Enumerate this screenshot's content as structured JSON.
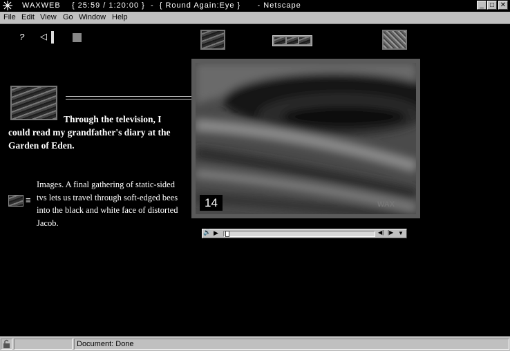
{
  "window": {
    "app_name": "WAXWEB",
    "timecode": "{ 25:59 / 1:20:00 }",
    "separator": "-",
    "page_title": "{ Round Again:Eye }",
    "browser_suffix": "- Netscape",
    "minimize_glyph": "_",
    "maximize_glyph": "□",
    "close_glyph": "✕"
  },
  "menu": {
    "items": [
      "File",
      "Edit",
      "View",
      "Go",
      "Window",
      "Help"
    ]
  },
  "toolbar": {
    "help_glyph": "?",
    "back_glyph": "◁"
  },
  "content": {
    "caption": "Through the television, I could read my grandfather's diary at the Garden of Eden.",
    "images_note": "Images. A final gathering of static-sided tvs lets us travel through soft-edged bees into the black and white face of distorted Jacob.",
    "list_glyph": "≡"
  },
  "video": {
    "frame_number": "14",
    "watermark": "WAX",
    "controller": {
      "volume_glyph": "🔊",
      "play_glyph": "▶",
      "step_back_glyph": "◀|",
      "step_forward_glyph": "|▶",
      "menu_glyph": "▼",
      "position": 0.01
    }
  },
  "status": {
    "text": "Document: Done"
  }
}
